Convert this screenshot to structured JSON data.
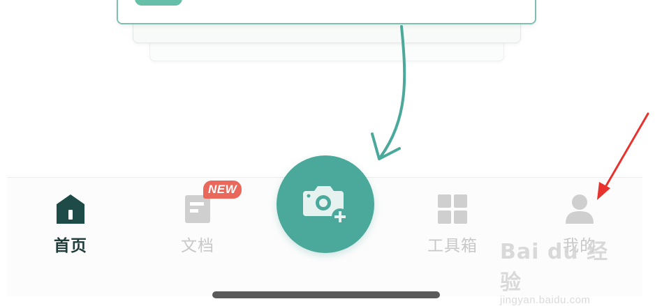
{
  "tabbar": {
    "tabs": [
      {
        "label": "首页",
        "icon": "home-icon",
        "active": true
      },
      {
        "label": "文档",
        "icon": "document-icon",
        "active": false,
        "badge": "NEW"
      },
      {
        "label": "工具箱",
        "icon": "grid-icon",
        "active": false
      },
      {
        "label": "我的",
        "icon": "user-icon",
        "active": false
      }
    ],
    "camera_button": {
      "icon": "camera-add-icon"
    }
  },
  "watermark": {
    "brand": "Bai du 经验",
    "url": "jingyan.baidu.com"
  },
  "colors": {
    "accent": "#4aa99a",
    "active_tab_text": "#1e3c3a",
    "inactive_tab": "#c8c8c8",
    "badge": "#e9675b",
    "annotation_arrow": "#e8322d"
  }
}
